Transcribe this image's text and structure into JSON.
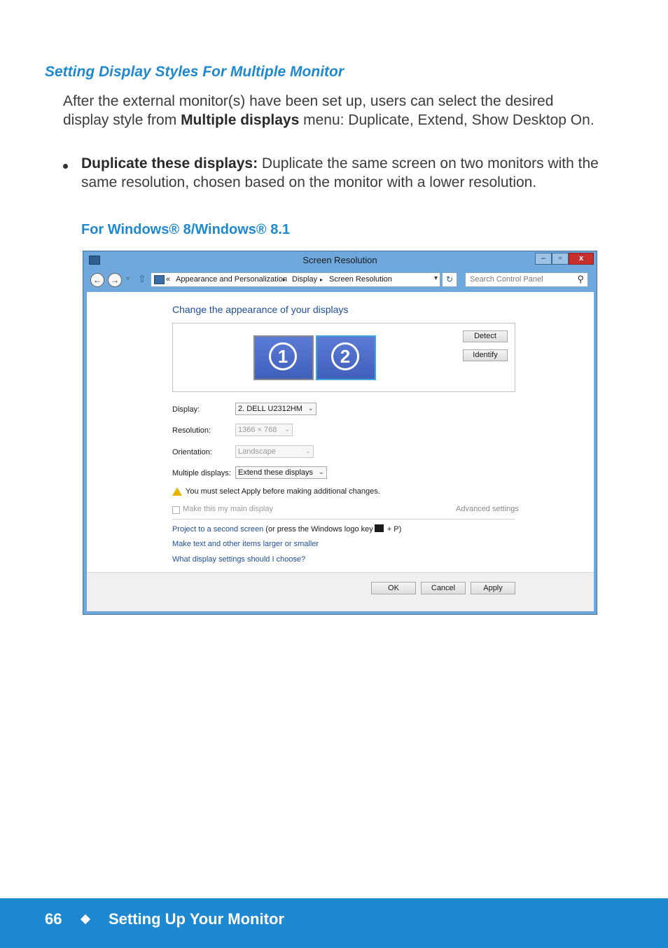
{
  "section_title": "Setting Display Styles For Multiple Monitor",
  "intro": {
    "before": "After the external monitor(s) have been set up, users can select the desired display style from ",
    "bold": "Multiple displays",
    "after": " menu:  Duplicate, Extend, Show Desktop On."
  },
  "bullet": {
    "bold": "Duplicate these displays:",
    "text": " Duplicate the same screen on two monitors with the same resolution, chosen based on the monitor with a lower resolution."
  },
  "subsection_title": "For Windows® 8/Windows® 8.1",
  "window": {
    "title": "Screen Resolution",
    "controls": {
      "minimize": "–",
      "maximize": "▫",
      "close": "x"
    },
    "nav": {
      "back_icon": "←",
      "forward_icon": "→",
      "up_icon": "⇧"
    },
    "breadcrumb": {
      "prefix": "«",
      "items": [
        "Appearance and Personalization",
        "Display",
        "Screen Resolution"
      ],
      "separator": "▸"
    },
    "refresh_icon": "↻",
    "search_placeholder": "Search Control Panel",
    "heading": "Change the appearance of your displays",
    "monitors": [
      "1",
      "2"
    ],
    "detect_label": "Detect",
    "identify_label": "Identify",
    "display_label": "Display:",
    "display_value": "2. DELL U2312HM",
    "resolution_label": "Resolution:",
    "resolution_value": "1366 × 768",
    "orientation_label": "Orientation:",
    "orientation_value": "Landscape",
    "multiple_label": "Multiple displays:",
    "multiple_value": "Extend these displays",
    "warning": "You must select Apply before making additional changes.",
    "main_display_label": "Make this my main display",
    "advanced_link": "Advanced settings",
    "link_project": "Project to a second screen",
    "link_project_note_before": " (or press the Windows logo key",
    "link_project_note_after": " + P)",
    "link_text_size": "Make text and other items larger or smaller",
    "link_what": "What display settings should I choose?",
    "ok_label": "OK",
    "cancel_label": "Cancel",
    "apply_label": "Apply"
  },
  "footer": {
    "page_number": "66",
    "title": "Setting Up Your Monitor"
  },
  "colors": {
    "accent": "#1e88d0",
    "window_frame": "#6fa8dc",
    "close": "#c7302c"
  }
}
